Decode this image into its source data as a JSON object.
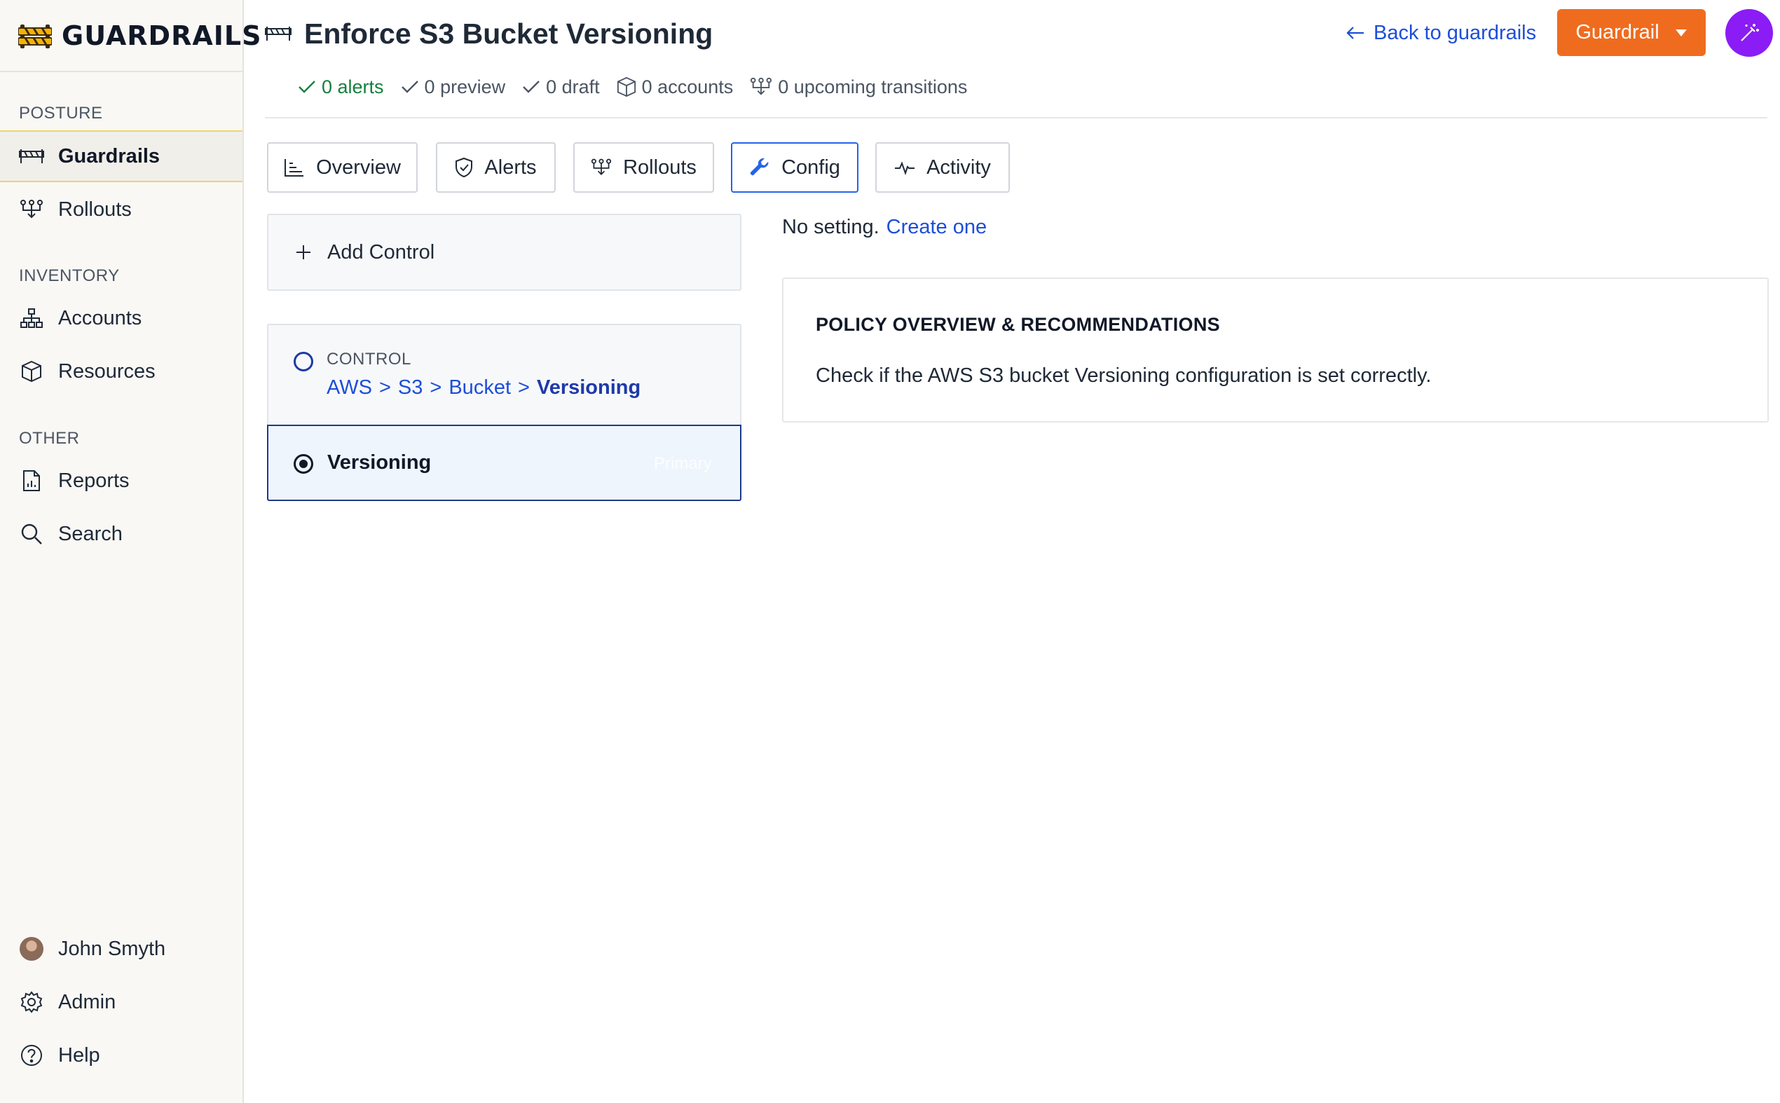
{
  "brand": {
    "name": "GUARDRAILS"
  },
  "sidebar": {
    "sections": [
      {
        "label": "POSTURE"
      },
      {
        "label": "INVENTORY"
      },
      {
        "label": "OTHER"
      }
    ],
    "items": [
      {
        "label": "Guardrails",
        "icon": "barrier-icon",
        "active": true
      },
      {
        "label": "Rollouts",
        "icon": "rollout-icon"
      },
      {
        "label": "Accounts",
        "icon": "hierarchy-icon"
      },
      {
        "label": "Resources",
        "icon": "cube-icon"
      },
      {
        "label": "Reports",
        "icon": "report-icon"
      },
      {
        "label": "Search",
        "icon": "search-icon"
      }
    ],
    "footer": [
      {
        "label": "John Smyth",
        "icon": "avatar"
      },
      {
        "label": "Admin",
        "icon": "gear-icon"
      },
      {
        "label": "Help",
        "icon": "help-icon"
      }
    ]
  },
  "header": {
    "title": "Enforce S3 Bucket Versioning",
    "stats": {
      "alerts": "0 alerts",
      "preview": "0 preview",
      "draft": "0 draft",
      "accounts": "0 accounts",
      "transitions": "0 upcoming transitions"
    },
    "back_label": "Back to guardrails",
    "guardrail_button": "Guardrail"
  },
  "tabs": [
    {
      "label": "Overview",
      "icon": "chart-icon"
    },
    {
      "label": "Alerts",
      "icon": "shield-icon"
    },
    {
      "label": "Rollouts",
      "icon": "rollout-icon"
    },
    {
      "label": "Config",
      "icon": "wrench-icon",
      "active": true
    },
    {
      "label": "Activity",
      "icon": "pulse-icon"
    }
  ],
  "controls": {
    "add_label": "Add Control",
    "control_label": "CONTROL",
    "path": [
      "AWS",
      "S3",
      "Bucket",
      "Versioning"
    ],
    "path_separator": ">",
    "selected": {
      "label": "Versioning",
      "tag": "Primary"
    }
  },
  "setting": {
    "empty_text": "No setting.",
    "create_link": "Create one"
  },
  "policy": {
    "title": "POLICY OVERVIEW & RECOMMENDATIONS",
    "description": "Check if the AWS S3 bucket Versioning configuration is set correctly."
  },
  "colors": {
    "accent_orange": "#ef6c1f",
    "link_blue": "#1d4ed8",
    "magic_purple": "#8b1cf5",
    "ok_green": "#15803d",
    "active_highlight": "#f2d36b"
  }
}
